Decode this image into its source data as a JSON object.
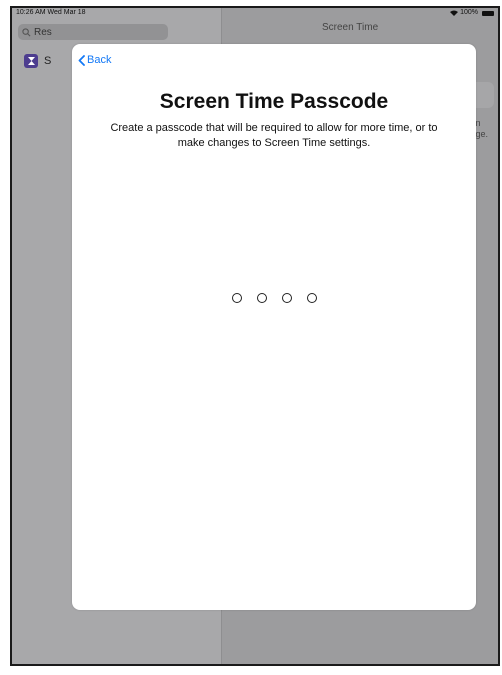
{
  "status_bar": {
    "time": "10:26 AM",
    "date": "Wed Mar 18",
    "battery": "100%",
    "icons": [
      "wifi-icon",
      "battery-icon"
    ]
  },
  "sidebar": {
    "search_value": "Res",
    "item_initial": "S",
    "item_icon": "hourglass-icon",
    "icon_color": "#4d3d8f"
  },
  "detail": {
    "title_fragment": "Screen Time",
    "side_text_1": "n",
    "side_text_2": "ge."
  },
  "modal": {
    "back_label": "Back",
    "title": "Screen Time Passcode",
    "subtitle_line1": "Create a passcode that will be required to allow for more time, or to",
    "subtitle_line2": "make changes to Screen Time settings.",
    "digits": 4,
    "accent": "#1479f6"
  }
}
